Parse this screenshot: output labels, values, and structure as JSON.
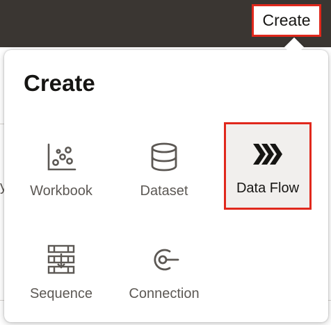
{
  "header": {
    "create_button_label": "Create"
  },
  "background": {
    "partial_text": "y"
  },
  "popup": {
    "title": "Create",
    "items": [
      {
        "id": "workbook",
        "label": "Workbook",
        "icon": "scatter-chart-icon",
        "selected": false
      },
      {
        "id": "dataset",
        "label": "Dataset",
        "icon": "database-icon",
        "selected": false
      },
      {
        "id": "dataflow",
        "label": "Data Flow",
        "icon": "chevrons-right-icon",
        "selected": true
      },
      {
        "id": "sequence",
        "label": "Sequence",
        "icon": "sequence-icon",
        "selected": false
      },
      {
        "id": "connection",
        "label": "Connection",
        "icon": "connection-icon",
        "selected": false
      }
    ]
  },
  "colors": {
    "topbar": "#3a3632",
    "highlight": "#e0281c",
    "icon": "#5c5854",
    "text": "#161513",
    "selected_bg": "#f1efed"
  }
}
